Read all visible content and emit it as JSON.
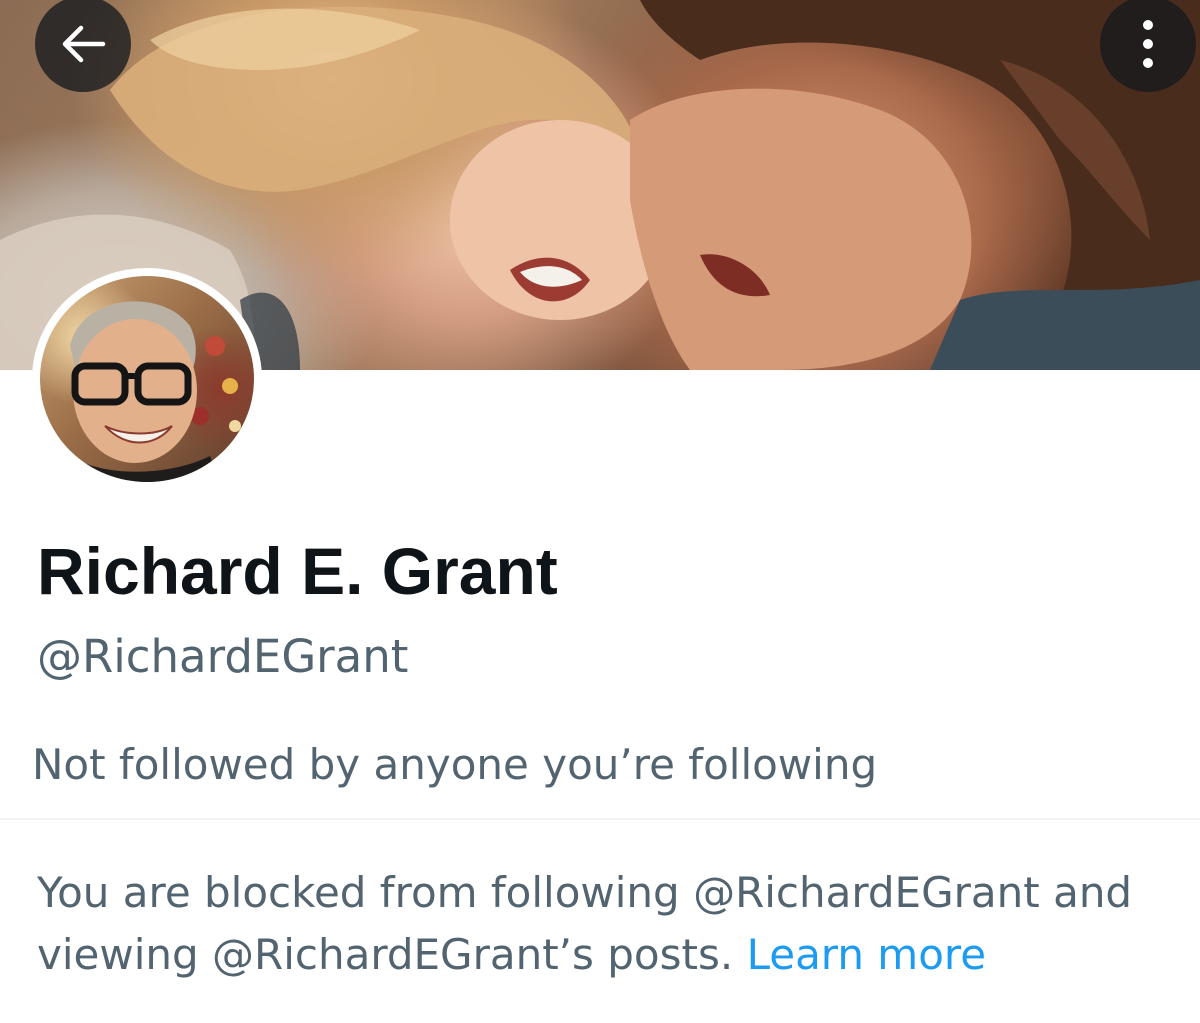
{
  "header": {
    "back_icon": "arrow-left-icon",
    "more_icon": "more-vertical-icon"
  },
  "profile": {
    "display_name": "Richard E. Grant",
    "handle": "@RichardEGrant",
    "followed_by": "Not followed by anyone you’re following"
  },
  "blocked_notice": {
    "text": "You are blocked from following @RichardEGrant and viewing @RichardEGrant’s posts.",
    "link_label": "Learn more"
  },
  "colors": {
    "primary_text": "#0f1419",
    "secondary_text": "#536471",
    "link": "#1d9bf0",
    "divider": "#eff3f4"
  }
}
